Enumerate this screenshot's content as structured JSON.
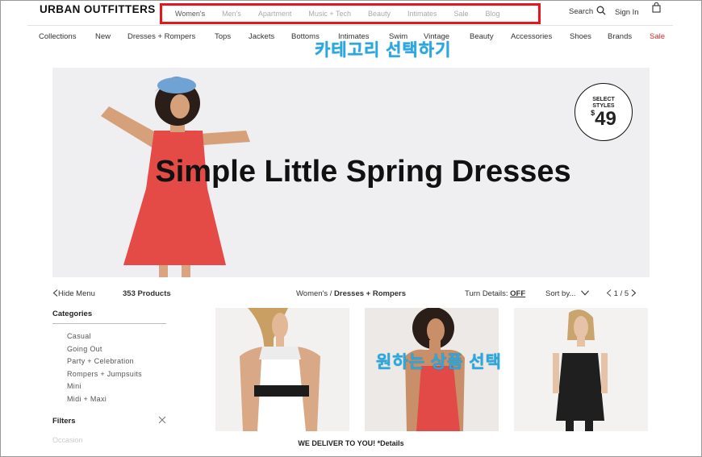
{
  "header": {
    "logo": "URBAN OUTFITTERS",
    "top_nav": [
      "Women's",
      "Men's",
      "Apartment",
      "Music + Tech",
      "Beauty",
      "Intimates",
      "Sale",
      "Blog"
    ],
    "search_label": "Search",
    "signin_label": "Sign In"
  },
  "category_nav": [
    "Collections",
    "New",
    "Dresses + Rompers",
    "Tops",
    "Jackets",
    "Bottoms",
    "Intimates",
    "Swim",
    "Vintage",
    "Beauty",
    "Accessories",
    "Shoes",
    "Brands",
    "Sale"
  ],
  "annotations": {
    "select_category": "카테고리 선택하기",
    "select_product": "원하는 상품 선택"
  },
  "hero": {
    "title": "Simple Little Spring Dresses",
    "badge_line1": "SELECT",
    "badge_line2": "STYLES",
    "badge_currency": "$",
    "badge_price": "49"
  },
  "toolbar": {
    "hide_menu": "Hide Menu",
    "product_count": "353 Products",
    "breadcrumb_parent": "Women's",
    "breadcrumb_sep": " / ",
    "breadcrumb_current": "Dresses + Rompers",
    "turn_details_label": "Turn Details:",
    "turn_details_value": "OFF",
    "sort_label": "Sort by...",
    "page_current": "1",
    "page_sep": "/",
    "page_total": "5"
  },
  "sidebar": {
    "categories_heading": "Categories",
    "categories": [
      "Casual",
      "Going Out",
      "Party + Celebration",
      "Rompers + Jumpsuits",
      "Mini",
      "Midi + Maxi"
    ],
    "filters_heading": "Filters",
    "occasion_label": "Occasion"
  },
  "footer_banner": "WE DELIVER TO YOU! *Details",
  "colors": {
    "highlight_box": "#e8151b",
    "annotation_text": "#27a9e1",
    "sale_red": "#e0262b",
    "hero_bg": "#efeef0"
  }
}
